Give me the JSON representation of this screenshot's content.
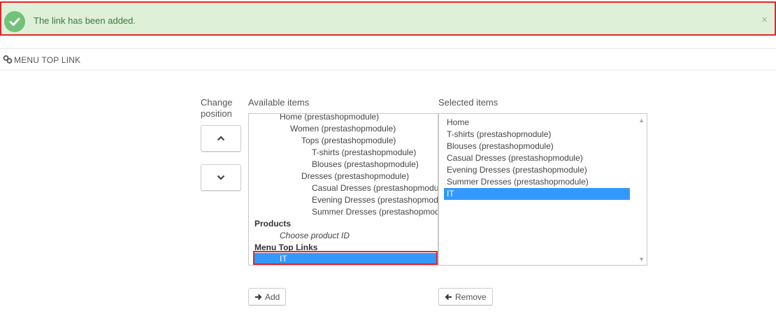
{
  "alert": {
    "message": "The link has been added.",
    "close": "×"
  },
  "panel": {
    "title": "MENU TOP LINK"
  },
  "labels": {
    "change_position": "Change position",
    "available": "Available items",
    "selected": "Selected items"
  },
  "available_items": [
    {
      "label": "Home (prestashopmodule)",
      "kind": "item"
    },
    {
      "label": "Women (prestashopmodule)",
      "kind": "item"
    },
    {
      "label": "Tops (prestashopmodule)",
      "kind": "item"
    },
    {
      "label": "T-shirts (prestashopmodule)",
      "kind": "item"
    },
    {
      "label": "Blouses (prestashopmodule)",
      "kind": "item"
    },
    {
      "label": "Dresses (prestashopmodule)",
      "kind": "item"
    },
    {
      "label": "Casual Dresses (prestashopmodule)",
      "kind": "item"
    },
    {
      "label": "Evening Dresses (prestashopmodule)",
      "kind": "item"
    },
    {
      "label": "Summer Dresses (prestashopmodule)",
      "kind": "item"
    },
    {
      "label": "Products",
      "kind": "group"
    },
    {
      "label": "Choose product ID",
      "kind": "placeholder"
    },
    {
      "label": "Menu Top Links",
      "kind": "group"
    },
    {
      "label": "IT",
      "kind": "item",
      "selected": true
    }
  ],
  "selected_items": [
    {
      "label": "Home"
    },
    {
      "label": "T-shirts (prestashopmodule)"
    },
    {
      "label": "Blouses (prestashopmodule)"
    },
    {
      "label": "Casual Dresses (prestashopmodule)"
    },
    {
      "label": "Evening Dresses (prestashopmodule)"
    },
    {
      "label": "Summer Dresses (prestashopmodule)"
    },
    {
      "label": "IT",
      "selected": true
    }
  ],
  "buttons": {
    "add": "Add",
    "remove": "Remove"
  },
  "colors": {
    "success_bg": "#dff0d8",
    "success_text": "#3c763d",
    "highlight": "#3399ff",
    "annotation": "#e0262c"
  }
}
